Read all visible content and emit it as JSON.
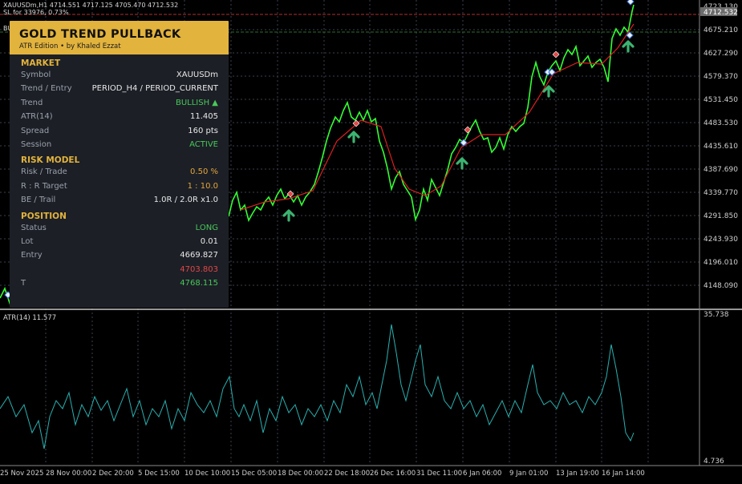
{
  "header": {
    "line1": "XAUUSDm,H1  4714.551 4717.125 4705.470 4712.532",
    "line2": "SL for 33976, 0.73%",
    "tag": "BU"
  },
  "price_axis": {
    "labels": [
      "4723.130",
      "4675.210",
      "4627.290",
      "4579.370",
      "4531.450",
      "4483.530",
      "4435.610",
      "4387.690",
      "4339.770",
      "4291.850",
      "4243.930",
      "4196.010",
      "4148.090"
    ],
    "current_price": "4712.532"
  },
  "indicator": {
    "title": "ATR(14) 11.577",
    "axis_max": "35.738",
    "axis_min": "4.736"
  },
  "time_axis": [
    "25 Nov 2025",
    "28 Nov 00:00",
    "2 Dec 20:00",
    "5 Dec 15:00",
    "10 Dec 10:00",
    "15 Dec 05:00",
    "18 Dec 00:00",
    "22 Dec 18:00",
    "26 Dec 16:00",
    "31 Dec 11:00",
    "6 Jan 06:00",
    "9 Jan 01:00",
    "13 Jan 19:00",
    "16 Jan 14:00"
  ],
  "panel": {
    "title": "GOLD TREND PULLBACK",
    "subtitle": "ATR Edition   •   by Khaled Ezzat",
    "market_header": "MARKET",
    "market": [
      {
        "label": "Symbol",
        "value": "XAUUSDm"
      },
      {
        "label": "Trend / Entry",
        "value": "PERIOD_H4  /  PERIOD_CURRENT"
      },
      {
        "label": "Trend",
        "value": "BULLISH ▲"
      },
      {
        "label": "ATR(14)",
        "value": "11.405"
      },
      {
        "label": "Spread",
        "value": "160 pts"
      },
      {
        "label": "Session",
        "value": "ACTIVE"
      }
    ],
    "risk_header": "RISK MODEL",
    "risk": [
      {
        "label": "Risk / Trade",
        "value": "0.50 %"
      },
      {
        "label": "R : R Target",
        "value": "1 : 10.0"
      },
      {
        "label": "BE / Trail",
        "value": "1.0R  /  2.0R x1.0"
      }
    ],
    "position_header": "POSITION",
    "position": [
      {
        "label": "Status",
        "value": "LONG"
      },
      {
        "label": "Lot",
        "value": "0.01"
      },
      {
        "label": "Entry",
        "value": "4669.827"
      },
      {
        "label": "",
        "value": "4703.803"
      },
      {
        "label": "T",
        "value": "4768.115"
      }
    ]
  },
  "colors": {
    "background": "#000000",
    "price_line": "#33ff33",
    "trend_line": "#dd1f1f",
    "indicator_line": "#2ab0b0",
    "panel_bg": "#1c1f26",
    "panel_accent": "#e2b33d",
    "buy_arrow": "#3cb371"
  },
  "icons": {
    "buy_signal": "up-arrow-icon",
    "entry_marker": "diamond-icon"
  }
}
